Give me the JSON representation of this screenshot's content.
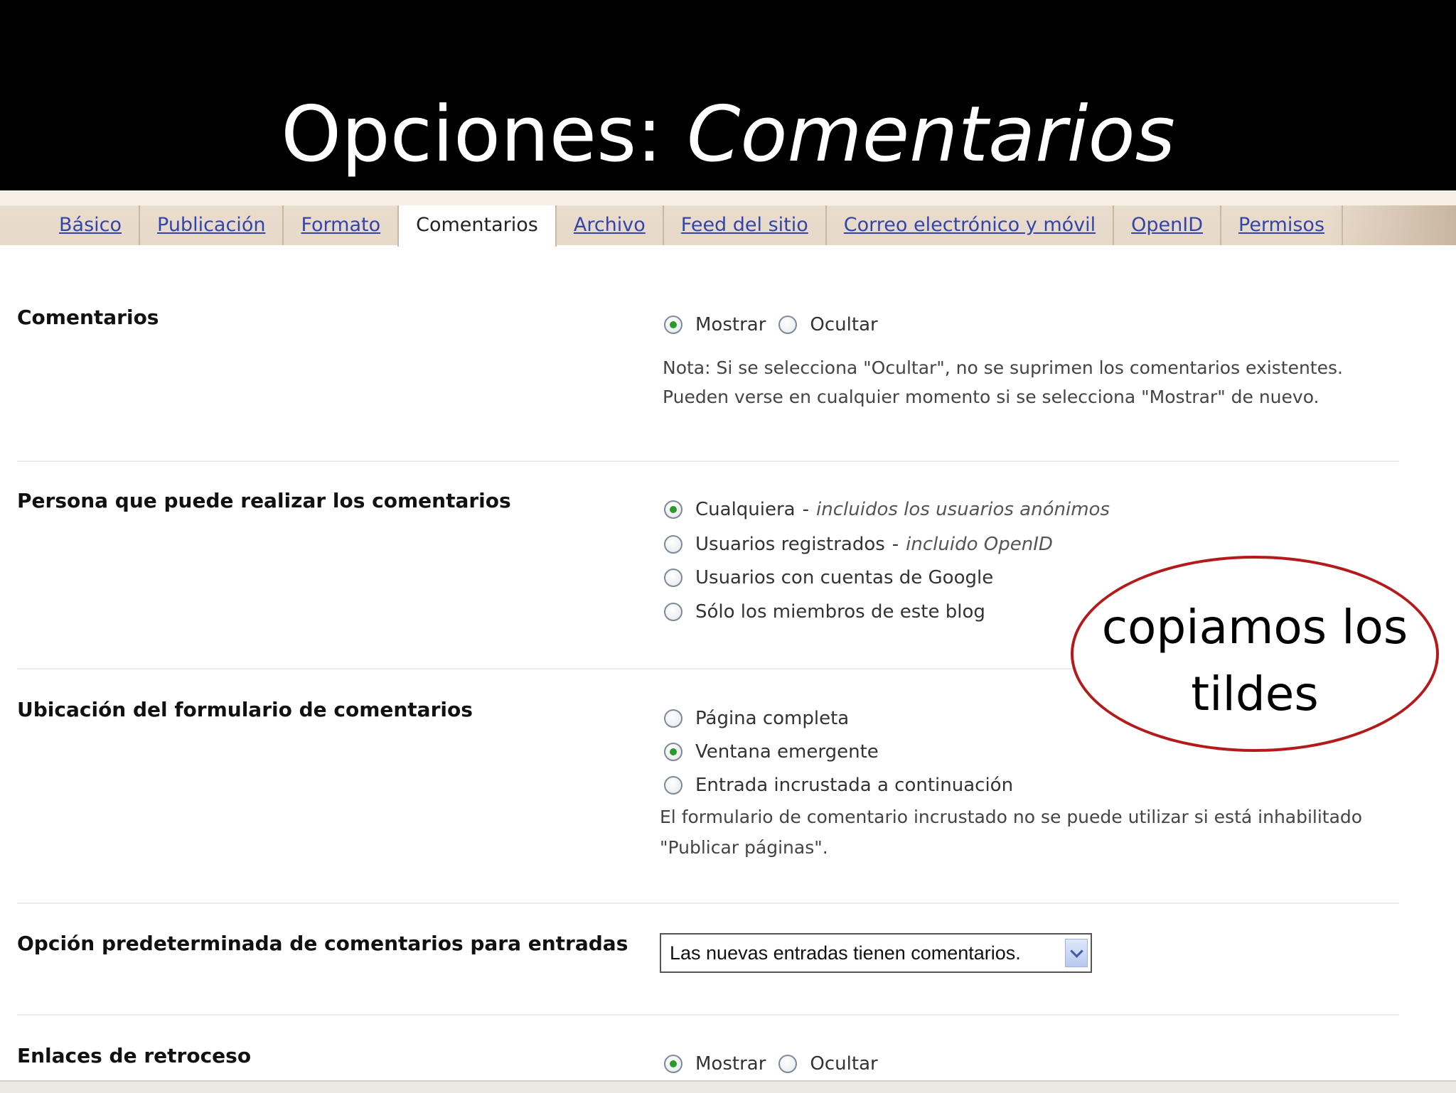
{
  "slide": {
    "title_prefix": "Opciones: ",
    "title_emphasis": "Comentarios"
  },
  "tabs": [
    {
      "label": "Básico",
      "active": false
    },
    {
      "label": "Publicación",
      "active": false
    },
    {
      "label": "Formato",
      "active": false
    },
    {
      "label": "Comentarios",
      "active": true
    },
    {
      "label": "Archivo",
      "active": false
    },
    {
      "label": "Feed del sitio",
      "active": false
    },
    {
      "label": "Correo electrónico y móvil",
      "active": false
    },
    {
      "label": "OpenID",
      "active": false
    },
    {
      "label": "Permisos",
      "active": false
    }
  ],
  "sections": {
    "comentarios": {
      "label": "Comentarios",
      "option_show": "Mostrar",
      "option_hide": "Ocultar",
      "note_line1": "Nota: Si se selecciona \"Ocultar\", no se suprimen los comentarios existentes.",
      "note_line2": "Pueden verse en cualquier momento si se selecciona \"Mostrar\" de nuevo."
    },
    "quien": {
      "label": "Persona que puede realizar los comentarios",
      "options": [
        {
          "text": "Cualquiera",
          "sep": "-",
          "sub": "incluidos los usuarios anónimos"
        },
        {
          "text": "Usuarios registrados",
          "sep": "-",
          "sub": "incluido OpenID"
        },
        {
          "text": "Usuarios con cuentas de Google"
        },
        {
          "text": "Sólo los miembros de este blog"
        }
      ]
    },
    "ubicacion": {
      "label": "Ubicación del formulario de comentarios",
      "options": [
        {
          "text": "Página completa"
        },
        {
          "text": "Ventana emergente"
        },
        {
          "text": "Entrada incrustada a continuación"
        }
      ],
      "note_line1": "El formulario de comentario incrustado no se puede utilizar si está inhabilitado",
      "note_line2": "\"Publicar páginas\"."
    },
    "predeterminada": {
      "label": "Opción predeterminada de comentarios para entradas",
      "select_value": "Las nuevas entradas tienen comentarios."
    },
    "retroceso": {
      "label": "Enlaces de retroceso",
      "option_show": "Mostrar",
      "option_hide": "Ocultar"
    }
  },
  "callout": {
    "line1": "copiamos los",
    "line2": "tildes"
  },
  "colors": {
    "callout_border": "#b31b1b",
    "link": "#3344aa",
    "radio_checked": "#2a9a2a"
  }
}
